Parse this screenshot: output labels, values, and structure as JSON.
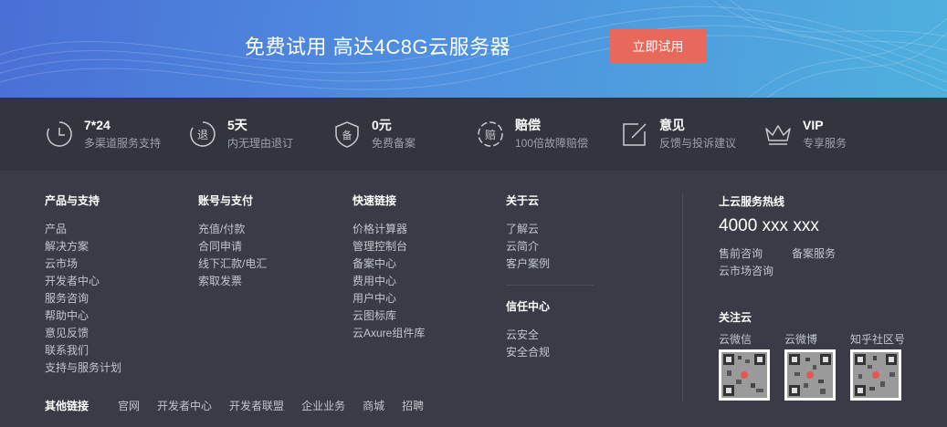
{
  "banner": {
    "title": "免费试用 高达4C8G云服务器",
    "cta_label": "立即试用"
  },
  "features": [
    {
      "icon": "clock-icon",
      "title": "7*24",
      "subtitle": "多渠道服务支持"
    },
    {
      "icon": "refund-icon",
      "glyph": "退",
      "title": "5天",
      "subtitle": "内无理由退订"
    },
    {
      "icon": "shield-icon",
      "glyph": "备",
      "title": "0元",
      "subtitle": "免费备案"
    },
    {
      "icon": "compensation-icon",
      "glyph": "赔",
      "title": "赔偿",
      "subtitle": "100倍故障赔偿"
    },
    {
      "icon": "feedback-icon",
      "title": "意见",
      "subtitle": "反馈与投诉建议"
    },
    {
      "icon": "crown-icon",
      "title": "VIP",
      "subtitle": "专享服务"
    }
  ],
  "columns": [
    {
      "title": "产品与支持",
      "links": [
        "产品",
        "解决方案",
        "云市场",
        "开发者中心",
        "服务咨询",
        "帮助中心",
        "意见反馈",
        "联系我们",
        "支持与服务计划"
      ]
    },
    {
      "title": "账号与支付",
      "links": [
        "充值/付款",
        "合同申请",
        "线下汇款/电汇",
        "索取发票"
      ]
    },
    {
      "title": "快速链接",
      "links": [
        "价格计算器",
        "管理控制台",
        "备案中心",
        "费用中心",
        "用户中心",
        "云图标库",
        "云Axure组件库"
      ]
    },
    {
      "title": "关于云",
      "links": [
        "了解云",
        "云简介",
        "客户案例"
      ]
    },
    {
      "title": "信任中心",
      "links": [
        "云安全",
        "安全合规"
      ]
    }
  ],
  "hotline": {
    "title": "上云服务热线",
    "number": "4000 xxx xxx",
    "services": [
      "售前咨询",
      "备案服务",
      "云市场咨询"
    ]
  },
  "follow": {
    "title": "关注云",
    "accounts": [
      "云微信",
      "云微博",
      "知乎社区号"
    ]
  },
  "other_links": {
    "label": "其他链接",
    "links": [
      "官网",
      "开发者中心",
      "开发者联盟",
      "企业业务",
      "商城",
      "招聘"
    ]
  }
}
